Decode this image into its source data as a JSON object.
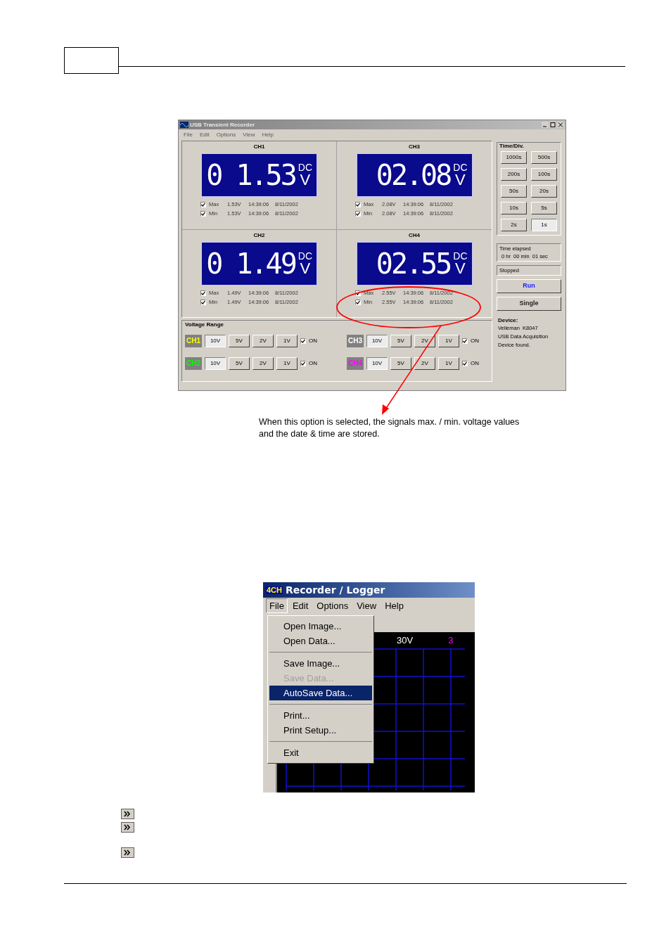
{
  "recorder_window": {
    "title": "USB Transient Recorder",
    "menu": [
      "File",
      "Edit",
      "Options",
      "View",
      "Help"
    ],
    "channels": [
      {
        "name": "CH1",
        "reading": "0 1.53",
        "unit_top": "DC",
        "unit_bottom": "V",
        "records": [
          {
            "label": "Max",
            "checked": true,
            "value": "1.53V",
            "time": "14:39:06",
            "date": "8/11/2002"
          },
          {
            "label": "Min",
            "checked": true,
            "value": "1.53V",
            "time": "14:39:06",
            "date": "8/11/2002"
          }
        ]
      },
      {
        "name": "CH3",
        "reading": "02.08",
        "unit_top": "DC",
        "unit_bottom": "V",
        "records": [
          {
            "label": "Max",
            "checked": true,
            "value": "2.08V",
            "time": "14:39:06",
            "date": "8/11/2002"
          },
          {
            "label": "Min",
            "checked": true,
            "value": "2.08V",
            "time": "14:39:06",
            "date": "8/11/2002"
          }
        ]
      },
      {
        "name": "CH2",
        "reading": "0 1.49",
        "unit_top": "DC",
        "unit_bottom": "V",
        "records": [
          {
            "label": "Max",
            "checked": true,
            "value": "1.49V",
            "time": "14:39:06",
            "date": "8/11/2002"
          },
          {
            "label": "Min",
            "checked": true,
            "value": "1.49V",
            "time": "14:39:06",
            "date": "8/11/2002"
          }
        ]
      },
      {
        "name": "CH4",
        "reading": "02.55",
        "unit_top": "DC",
        "unit_bottom": "V",
        "records": [
          {
            "label": "Max",
            "checked": true,
            "value": "2.55V",
            "time": "14:39:06",
            "date": "8/11/2002"
          },
          {
            "label": "Min",
            "checked": true,
            "value": "2.55V",
            "time": "14:39:06",
            "date": "8/11/2002"
          }
        ]
      }
    ],
    "voltage_range": {
      "title": "Voltage Range",
      "rows": [
        {
          "channel": "CH1",
          "color": "#ffff00",
          "ranges": [
            {
              "label": "10V",
              "selected": true
            },
            {
              "label": "5V",
              "selected": false
            },
            {
              "label": "2V",
              "selected": false
            },
            {
              "label": "1V",
              "selected": false
            }
          ],
          "on_label": "ON",
          "on": true
        },
        {
          "channel": "CH2",
          "color": "#00ff00",
          "ranges": [
            {
              "label": "10V",
              "selected": true
            },
            {
              "label": "5V",
              "selected": false
            },
            {
              "label": "2V",
              "selected": false
            },
            {
              "label": "1V",
              "selected": false
            }
          ],
          "on_label": "ON",
          "on": true
        },
        {
          "channel": "CH3",
          "color": "#ffffff",
          "ranges": [
            {
              "label": "10V",
              "selected": true
            },
            {
              "label": "5V",
              "selected": false
            },
            {
              "label": "2V",
              "selected": false
            },
            {
              "label": "1V",
              "selected": false
            }
          ],
          "on_label": "ON",
          "on": true
        },
        {
          "channel": "CH4",
          "color": "#ff00ff",
          "ranges": [
            {
              "label": "10V",
              "selected": true
            },
            {
              "label": "5V",
              "selected": false
            },
            {
              "label": "2V",
              "selected": false
            },
            {
              "label": "1V",
              "selected": false
            }
          ],
          "on_label": "ON",
          "on": true
        }
      ]
    },
    "time_div": {
      "title": "Time/Div.",
      "buttons": [
        {
          "label": "1000s",
          "selected": false
        },
        {
          "label": "500s",
          "selected": false
        },
        {
          "label": "200s",
          "selected": false
        },
        {
          "label": "100s",
          "selected": false
        },
        {
          "label": "50s",
          "selected": false
        },
        {
          "label": "20s",
          "selected": false
        },
        {
          "label": "10s",
          "selected": false
        },
        {
          "label": "5s",
          "selected": false
        },
        {
          "label": "2s",
          "selected": false
        },
        {
          "label": "1s",
          "selected": true
        }
      ]
    },
    "elapsed": {
      "label": "Time elapsed",
      "value": "0 hr  00 min  01 sec"
    },
    "status": "Stopped",
    "buttons": [
      {
        "label": "Run",
        "kind": "primary"
      },
      {
        "label": "Single",
        "kind": "bold"
      }
    ],
    "device": {
      "label": "Device:",
      "lines": [
        "Velleman  K8047",
        "USB Data Acquisition",
        "Device found."
      ]
    }
  },
  "caption": [
    "When this option is selected, the signals max. / min. voltage values",
    "and the date & time are stored."
  ],
  "logger_window": {
    "badge": "4CH",
    "title": "Recorder / Logger",
    "menu": [
      {
        "label": "File",
        "selected": true
      },
      {
        "label": "Edit",
        "selected": false
      },
      {
        "label": "Options",
        "selected": false
      },
      {
        "label": "View",
        "selected": false
      },
      {
        "label": "Help",
        "selected": false
      }
    ],
    "file_menu": [
      [
        {
          "label": "Open Image...",
          "disabled": false,
          "selected": false
        },
        {
          "label": "Open Data...",
          "disabled": false,
          "selected": false
        }
      ],
      [
        {
          "label": "Save Image...",
          "disabled": false,
          "selected": false
        },
        {
          "label": "Save Data...",
          "disabled": true,
          "selected": false
        },
        {
          "label": "AutoSave Data...",
          "disabled": false,
          "selected": true
        }
      ],
      [
        {
          "label": "Print...",
          "disabled": false,
          "selected": false
        },
        {
          "label": "Print Setup...",
          "disabled": false,
          "selected": false
        }
      ],
      [
        {
          "label": "Exit",
          "disabled": false,
          "selected": false
        }
      ]
    ],
    "scope_labels": [
      {
        "text": "30V",
        "color": "#ffffff"
      },
      {
        "text": "3",
        "color": "#ff00ff"
      }
    ]
  }
}
